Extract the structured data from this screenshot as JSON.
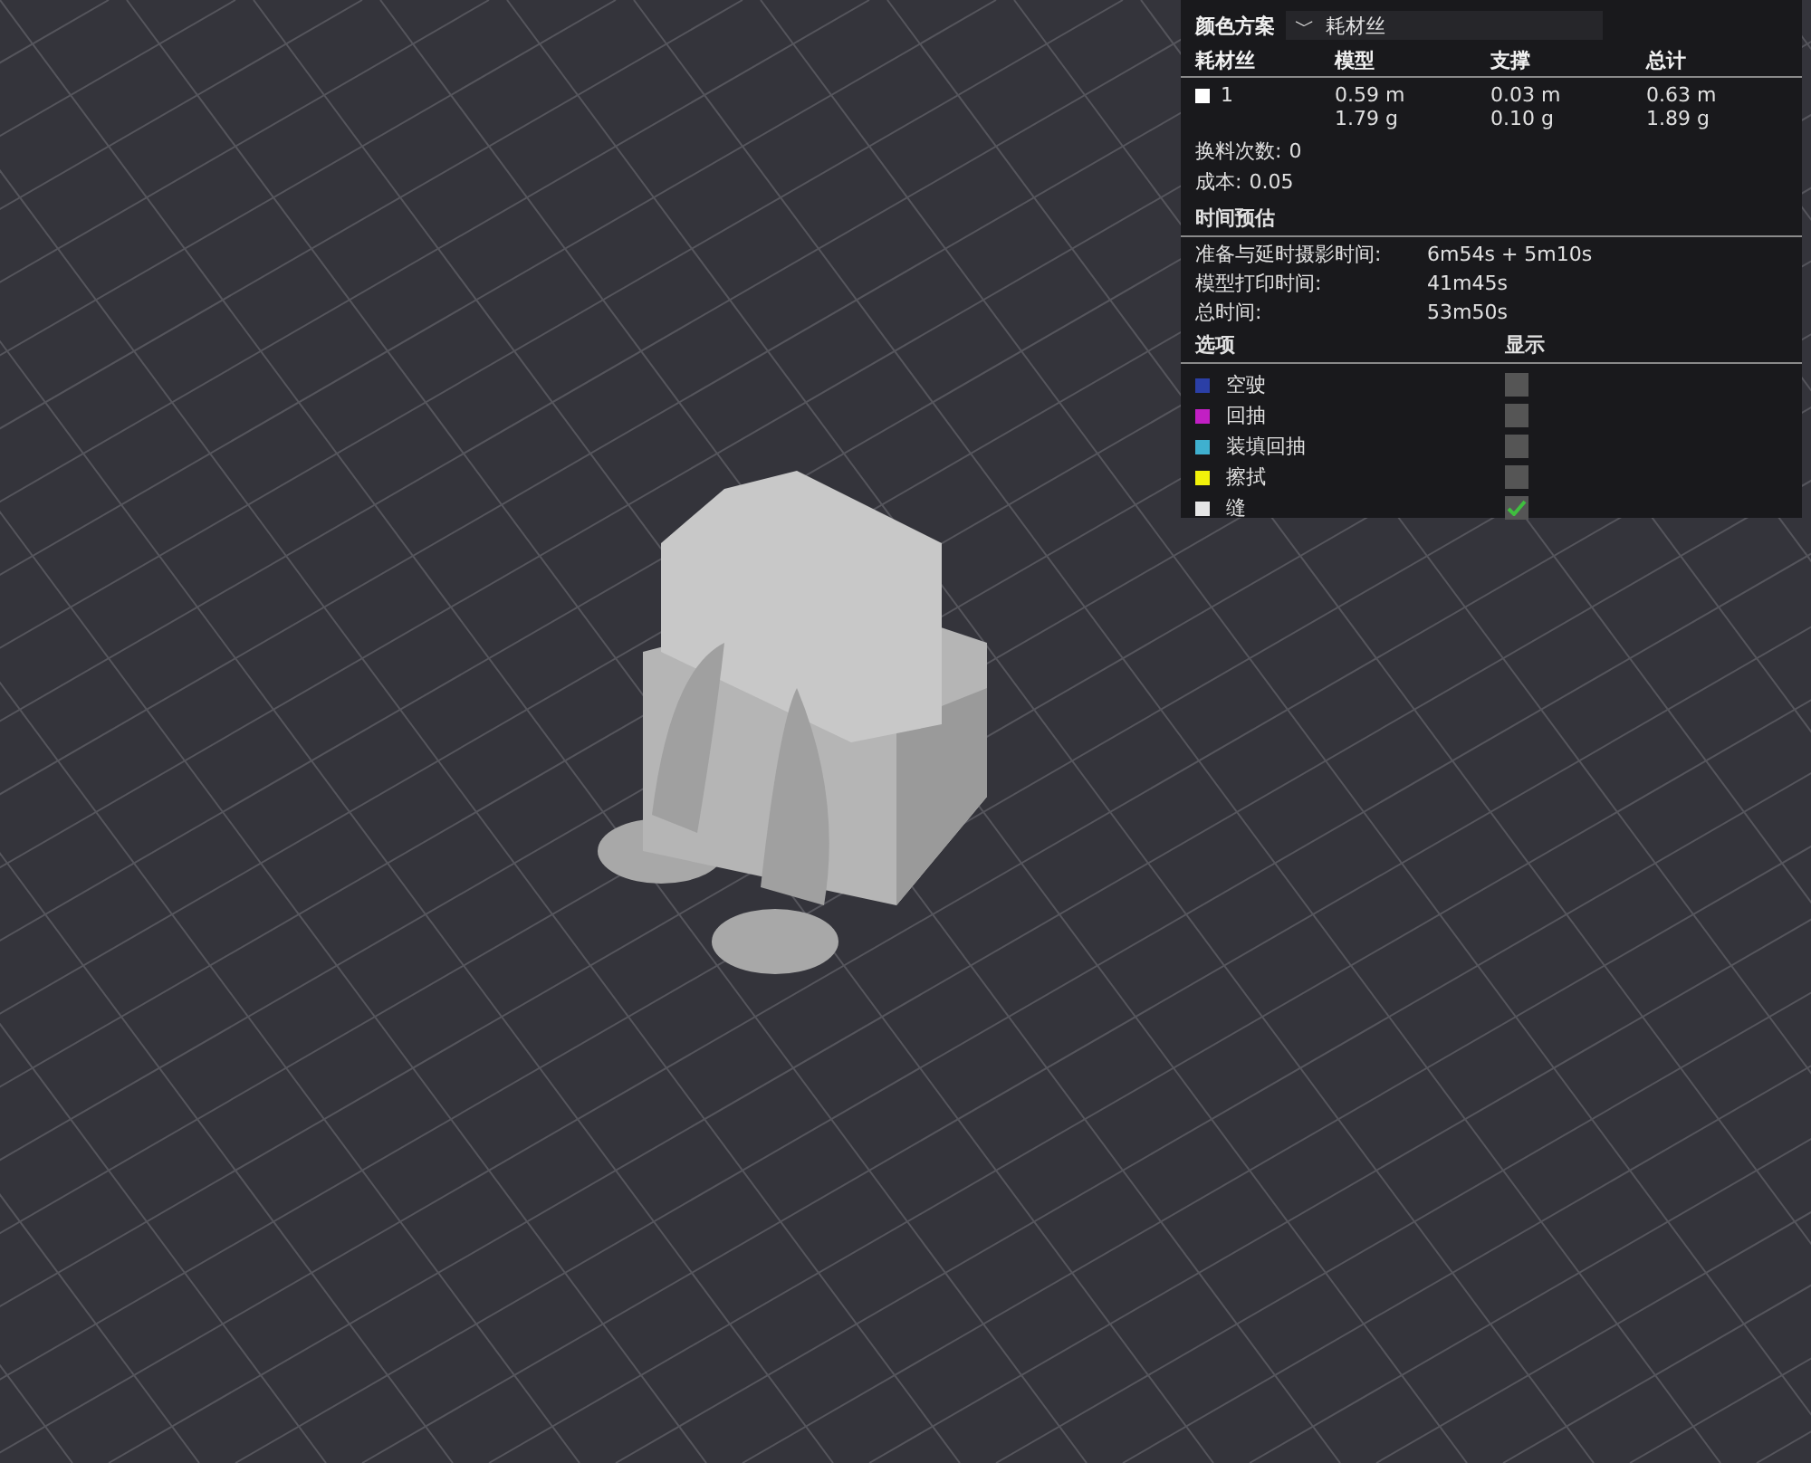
{
  "color_scheme": {
    "label": "颜色方案",
    "value": "耗材丝",
    "caret": "﹀"
  },
  "filament_table": {
    "columns": [
      "耗材丝",
      "模型",
      "支撑",
      "总计"
    ],
    "rows": [
      {
        "color": "#ffffff",
        "filament": "1",
        "model": [
          "0.59 m",
          "1.79 g"
        ],
        "support": [
          "0.03 m",
          "0.10 g"
        ],
        "total": [
          "0.63 m",
          "1.89 g"
        ]
      }
    ]
  },
  "stats": [
    {
      "label": "换料次数:",
      "value": "0"
    },
    {
      "label": "成本:",
      "value": "0.05"
    }
  ],
  "time_estimate": {
    "title": "时间预估",
    "rows": [
      {
        "label": "准备与延时摄影时间:",
        "value": "6m54s + 5m10s"
      },
      {
        "label": "模型打印时间:",
        "value": "41m45s"
      },
      {
        "label": "总时间:",
        "value": "53m50s"
      }
    ]
  },
  "options": {
    "columns": [
      "选项",
      "显示"
    ],
    "items": [
      {
        "label": "空驶",
        "color": "#2b3fa6",
        "checked": false
      },
      {
        "label": "回抽",
        "color": "#c21fc4",
        "checked": false
      },
      {
        "label": "装填回抽",
        "color": "#3fb0cf",
        "checked": false
      },
      {
        "label": "擦拭",
        "color": "#f2f20a",
        "checked": false
      },
      {
        "label": "缝",
        "color": "#e6e6e6",
        "checked": true
      }
    ]
  }
}
